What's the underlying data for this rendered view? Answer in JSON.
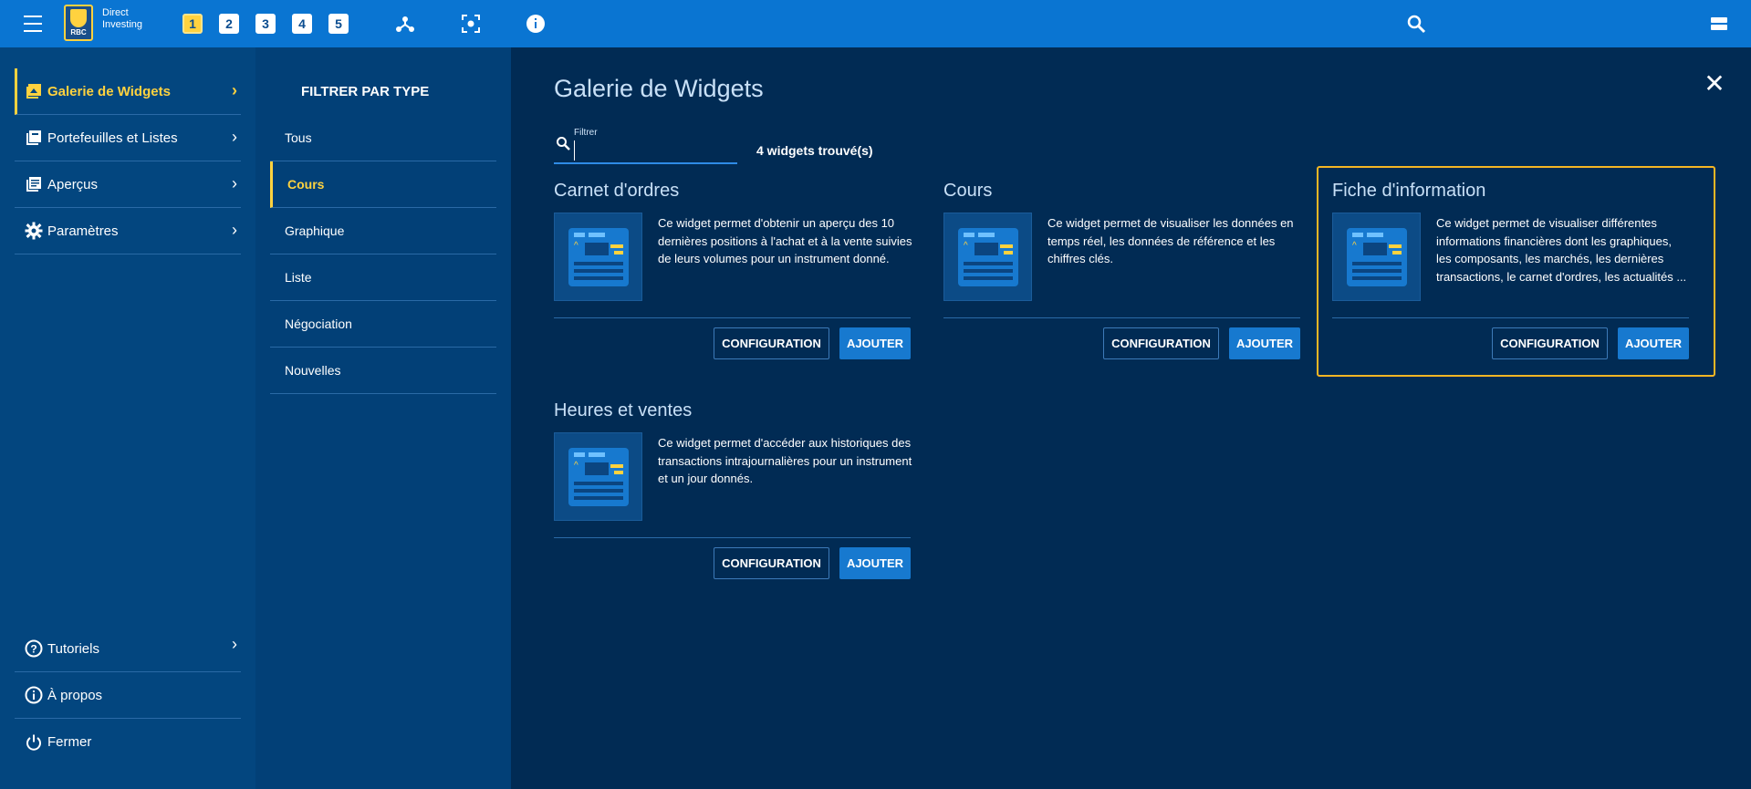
{
  "topbar": {
    "logo_text": "RBC",
    "brand_line1": "Direct",
    "brand_line2": "Investing",
    "workspaces": [
      "1",
      "2",
      "3",
      "4",
      "5"
    ],
    "active_workspace": "1"
  },
  "leftnav": {
    "items": [
      {
        "label": "Galerie de Widgets",
        "icon": "gallery-icon"
      },
      {
        "label": "Portefeuilles et Listes",
        "icon": "portfolio-icon"
      },
      {
        "label": "Aperçus",
        "icon": "overview-icon"
      },
      {
        "label": "Paramètres",
        "icon": "gear-icon"
      }
    ],
    "bottom_items": [
      {
        "label": "Tutoriels",
        "icon": "help-icon"
      },
      {
        "label": "À propos",
        "icon": "info-icon"
      },
      {
        "label": "Fermer",
        "icon": "power-icon"
      }
    ]
  },
  "filters": {
    "title": "FILTRER PAR TYPE",
    "items": [
      "Tous",
      "Cours",
      "Graphique",
      "Liste",
      "Négociation",
      "Nouvelles"
    ],
    "active": "Cours"
  },
  "gallery": {
    "title": "Galerie de Widgets",
    "search_label": "Filtrer",
    "search_value": "",
    "found_text": "4 widgets trouvé(s)",
    "cards": [
      {
        "title": "Carnet d'ordres",
        "desc": "Ce widget permet d'obtenir un aperçu des 10 dernières positions à l'achat et à la vente suivies de leurs volumes pour un instrument donné.",
        "config_label": "CONFIGURATION",
        "add_label": "AJOUTER"
      },
      {
        "title": "Cours",
        "desc": "Ce widget permet de visualiser les données en temps réel, les données de référence et les chiffres clés.",
        "config_label": "CONFIGURATION",
        "add_label": "AJOUTER"
      },
      {
        "title": "Fiche d'information",
        "desc": "Ce widget permet de visualiser différentes informations financières dont les graphiques, les composants, les marchés, les dernières transactions, le carnet d'ordres, les actualités ...",
        "config_label": "CONFIGURATION",
        "add_label": "AJOUTER"
      },
      {
        "title": "Heures et ventes",
        "desc": "Ce widget permet d'accéder aux historiques des transactions intrajournalières pour un instrument et un jour donnés.",
        "config_label": "CONFIGURATION",
        "add_label": "AJOUTER"
      }
    ]
  },
  "colors": {
    "topbar": "#0a75d2",
    "accent": "#ffd23f",
    "highlight_border": "#f5b624",
    "button_primary": "#1779cf"
  }
}
